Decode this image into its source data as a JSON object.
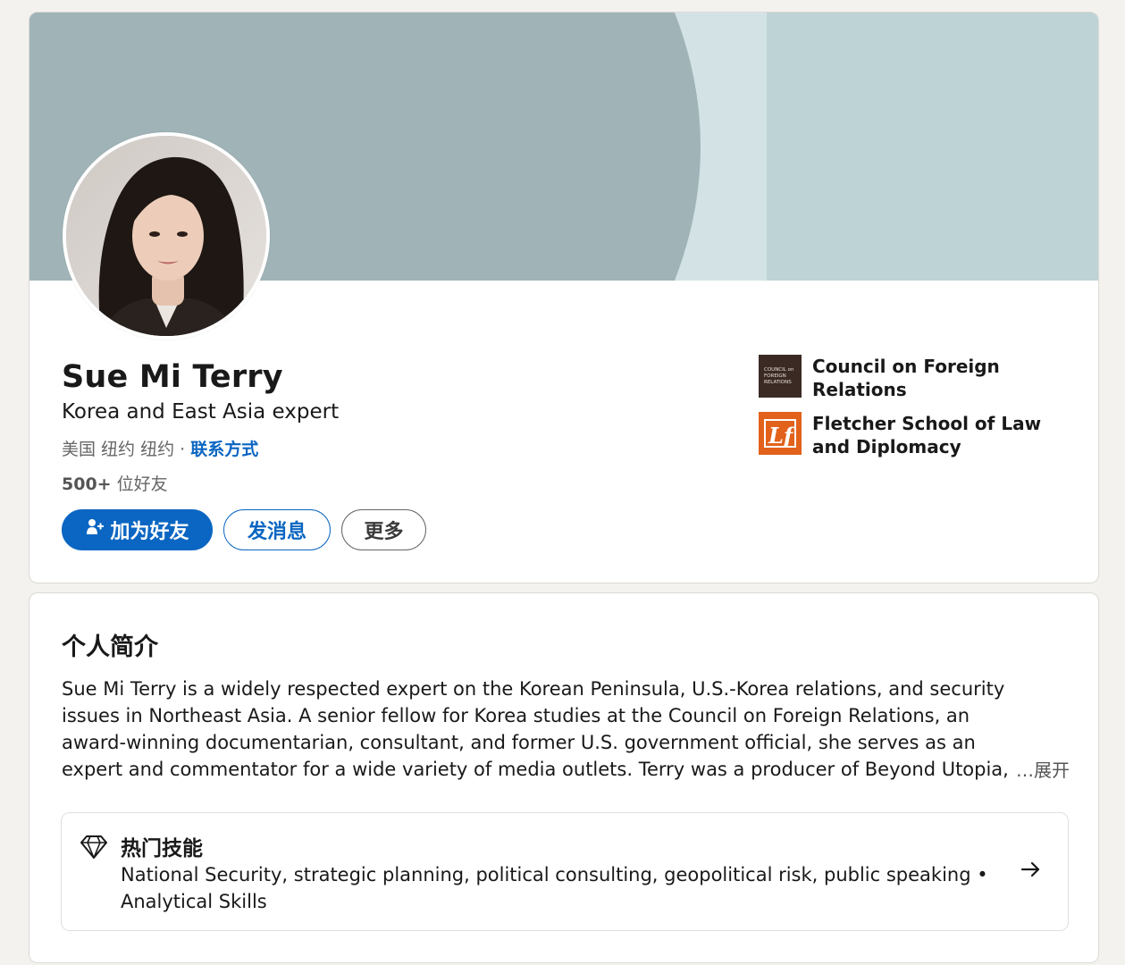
{
  "profile": {
    "name": "Sue Mi Terry",
    "headline": "Korea and East Asia expert",
    "location": "美国 纽约 纽约 · ",
    "contact_link": "联系方式",
    "connections_count": "500+",
    "connections_label": " 位好友"
  },
  "actions": {
    "connect_label": "加为好友",
    "message_label": "发消息",
    "more_label": "更多"
  },
  "orgs": [
    {
      "name": "Council on Foreign Relations",
      "logo_text": [
        "COUNCIL on",
        "FOREIGN",
        "RELATIONS"
      ],
      "logo_color": "#3b2a24"
    },
    {
      "name": "Fletcher School of Law and Diplomacy",
      "logo_text": "Lf",
      "logo_color": "#e2611b"
    }
  ],
  "about": {
    "title": "个人简介",
    "text": "Sue Mi Terry is a widely respected expert on the Korean Peninsula, U.S.-Korea relations, and security issues in Northeast Asia. A senior fellow for Korea studies at the Council on Foreign Relations, an award-winning documentarian, consultant, and former U.S. government official, she serves as an expert and commentator for a wide variety of media outlets. Terry was a producer of Beyond Utopia, an acclai",
    "expand_label": "…展开"
  },
  "skills": {
    "title": "热门技能",
    "list": "National Security, strategic planning, political consulting, geopolitical risk, public speaking • Analytical Skills",
    "icon": "diamond-icon"
  },
  "colors": {
    "brand_blue": "#0a66c2",
    "banner_dark": "#a0b4b8",
    "banner_light": "#bed3d6",
    "banner_mid": "#d3e3e5"
  }
}
